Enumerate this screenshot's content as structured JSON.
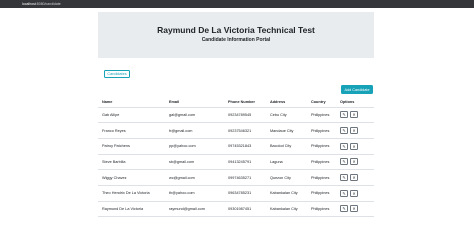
{
  "browser": {
    "url_host": "localhost",
    "url_path": ":8080/candidate"
  },
  "hero": {
    "title": "Raymund De La Victoria Technical Test",
    "subtitle": "Candidate Information Portal"
  },
  "nav_button_label": "Candidates",
  "add_button_label": "Add Candidate",
  "table": {
    "headers": [
      "Name",
      "Email",
      "Phone Number",
      "Address",
      "Country",
      "Options"
    ],
    "rows": [
      [
        "Gab Allipe",
        "gal@gmail.com",
        "09234789545",
        "Cebu City",
        "Philippines"
      ],
      [
        "Franco Reyes",
        "fr@gmail.com",
        "09237546321",
        "Mandaue City",
        "Philippines"
      ],
      [
        "Patroy Patchens",
        "pp@yahoo.com",
        "09745321843",
        "Bacolod City",
        "Philippines"
      ],
      [
        "Steve Barbilla",
        "sb@gmail.com",
        "09413245791",
        "Laguna",
        "Philippines"
      ],
      [
        "Wiggy Chavez",
        "wc@gmail.com",
        "09974635271",
        "Quezon City",
        "Philippines"
      ],
      [
        "Theo Hendrix De La Victoria",
        "th@yahoo.com",
        "09634785231",
        "Kabankalan City",
        "Philippines"
      ],
      [
        "Raymund De La Victoria",
        "raymund@gmail.com",
        "09301987451",
        "Kabankalan City",
        "Philippines"
      ]
    ]
  },
  "icons": {
    "edit": "pencil-icon",
    "delete": "trash-icon"
  },
  "colors": {
    "accent": "#17a2b8",
    "hero_bg": "#e9ecef"
  }
}
